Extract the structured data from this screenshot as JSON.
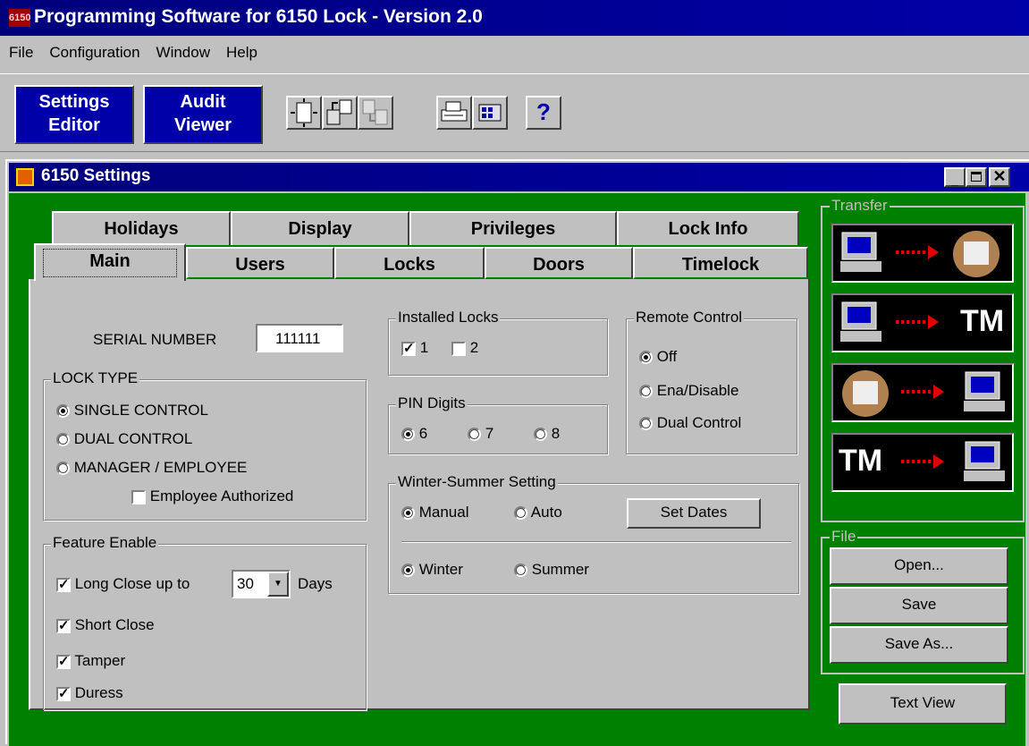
{
  "app": {
    "title": "Programming Software for 6150 Lock - Version 2.0",
    "icon_text": "6150"
  },
  "menu": [
    "File",
    "Configuration",
    "Window",
    "Help"
  ],
  "toolbar": {
    "settings_editor": [
      "Settings",
      "Editor"
    ],
    "audit_viewer": [
      "Audit",
      "Viewer"
    ]
  },
  "child_window": {
    "title": "6150 Settings"
  },
  "tabs_back": [
    "Holidays",
    "Display",
    "Privileges",
    "Lock Info"
  ],
  "tabs_front": [
    "Main",
    "Users",
    "Locks",
    "Doors",
    "Timelock"
  ],
  "main": {
    "serial_label": "SERIAL NUMBER",
    "serial_value": "111111",
    "lock_type": {
      "label": "LOCK TYPE",
      "options": [
        "SINGLE CONTROL",
        "DUAL CONTROL",
        "MANAGER / EMPLOYEE"
      ],
      "selected": "SINGLE CONTROL",
      "employee_authorized": "Employee Authorized"
    },
    "feature_enable": {
      "label": "Feature Enable",
      "long_close": "Long Close up to",
      "long_close_days": "30",
      "days": "Days",
      "short_close": "Short Close",
      "tamper": "Tamper",
      "duress": "Duress"
    },
    "installed_locks": {
      "label": "Installed Locks",
      "lock1": "1",
      "lock2": "2"
    },
    "pin_digits": {
      "label": "PIN Digits",
      "options": [
        "6",
        "7",
        "8"
      ],
      "selected": "6"
    },
    "remote_control": {
      "label": "Remote Control",
      "options": [
        "Off",
        "Ena/Disable",
        "Dual Control"
      ],
      "selected": "Off"
    },
    "winter_summer": {
      "label": "Winter-Summer Setting",
      "manual": "Manual",
      "auto": "Auto",
      "set_dates": "Set Dates",
      "winter": "Winter",
      "summer": "Summer"
    }
  },
  "transfer": {
    "label": "Transfer",
    "tm": "TM"
  },
  "file_group": {
    "label": "File",
    "open": "Open...",
    "save": "Save",
    "save_as": "Save As..."
  },
  "text_view": "Text View",
  "colors": {
    "title_blue": "#0000a8",
    "panel_green": "#008000",
    "face": "#c0c0c0"
  }
}
